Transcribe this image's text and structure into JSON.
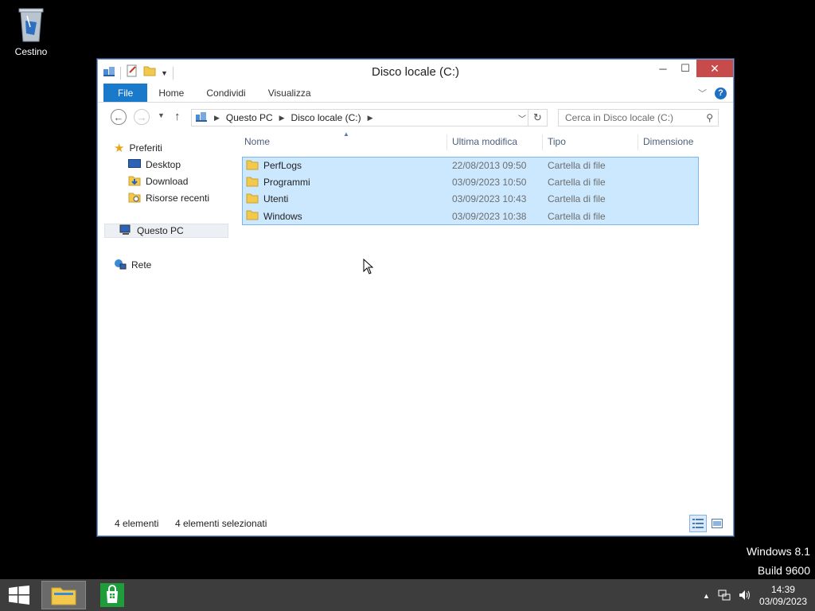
{
  "desktop": {
    "recycle_bin_label": "Cestino",
    "watermark_line1": "Windows 8.1",
    "watermark_line2": "Build 9600"
  },
  "window": {
    "title": "Disco locale (C:)",
    "controls": {
      "minimize": "─",
      "maximize": "☐",
      "close": "✕"
    }
  },
  "ribbon": {
    "tabs": [
      {
        "label": "File",
        "active": true
      },
      {
        "label": "Home"
      },
      {
        "label": "Condividi"
      },
      {
        "label": "Visualizza"
      }
    ],
    "help_label": "?"
  },
  "navigation": {
    "back": "←",
    "forward": "→",
    "up": "↑",
    "breadcrumb": [
      "Questo PC",
      "Disco locale (C:)"
    ],
    "search_placeholder": "Cerca in Disco locale (C:)"
  },
  "nav_pane": {
    "favorites": "Preferiti",
    "favorites_items": [
      "Desktop",
      "Download",
      "Risorse recenti"
    ],
    "this_pc": "Questo PC",
    "network": "Rete"
  },
  "file_list": {
    "columns": [
      "Nome",
      "Ultima modifica",
      "Tipo",
      "Dimensione"
    ],
    "rows": [
      {
        "name": "PerfLogs",
        "modified": "22/08/2013 09:50",
        "type": "Cartella di file",
        "size": ""
      },
      {
        "name": "Programmi",
        "modified": "03/09/2023 10:50",
        "type": "Cartella di file",
        "size": ""
      },
      {
        "name": "Utenti",
        "modified": "03/09/2023 10:43",
        "type": "Cartella di file",
        "size": ""
      },
      {
        "name": "Windows",
        "modified": "03/09/2023 10:38",
        "type": "Cartella di file",
        "size": ""
      }
    ]
  },
  "status_bar": {
    "item_count": "4 elementi",
    "selected_count": "4 elementi selezionati"
  },
  "taskbar": {
    "time": "14:39",
    "date": "03/09/2023"
  },
  "colors": {
    "selection_bg": "#cce8ff",
    "selection_border": "#7eb4ea",
    "file_tab": "#1979ca",
    "close_button": "#c74b4b",
    "taskbar": "#3d3d3d"
  }
}
